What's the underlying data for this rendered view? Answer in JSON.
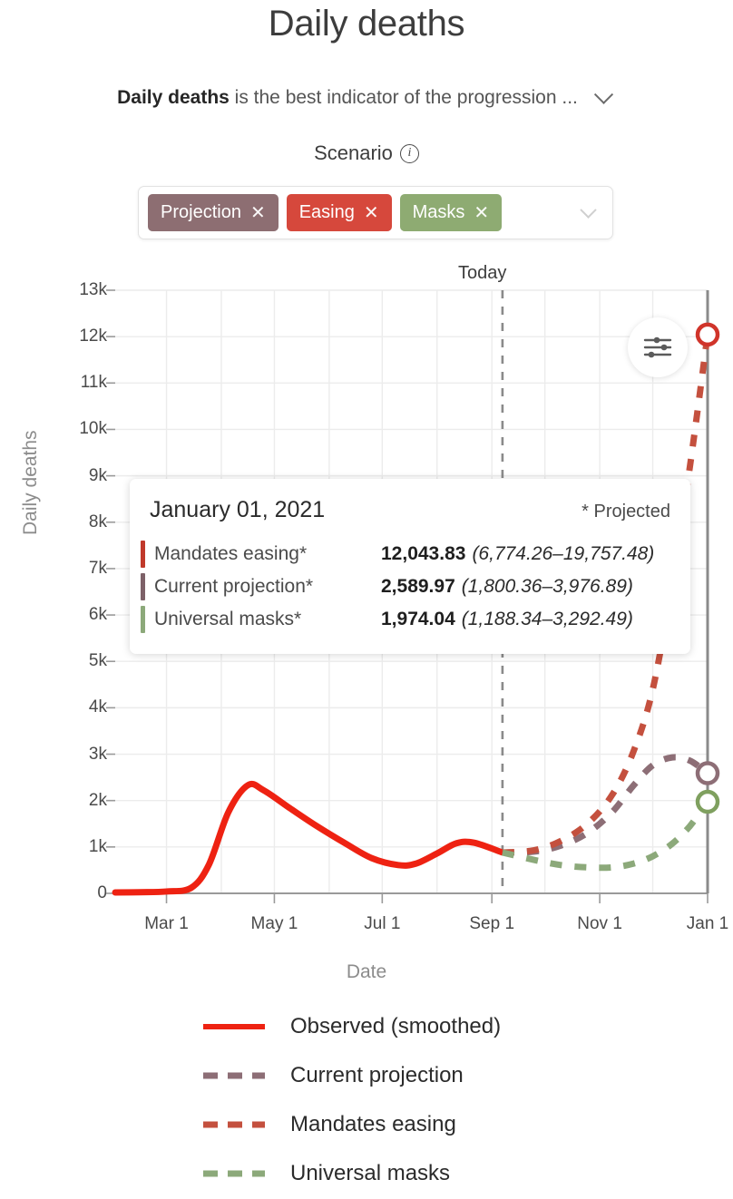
{
  "header": {
    "title": "Daily deaths",
    "subtitle_bold": "Daily deaths",
    "subtitle_rest": " is the best indicator of the progression ...",
    "expand_icon": "chevron-down-icon"
  },
  "scenario": {
    "label": "Scenario",
    "info_icon": "info-icon",
    "pills": [
      {
        "label": "Projection",
        "close": "✕",
        "color": "#8d6e72"
      },
      {
        "label": "Easing",
        "close": "✕",
        "color": "#d6483c"
      },
      {
        "label": "Masks",
        "close": "✕",
        "color": "#8eab72"
      }
    ],
    "dropdown_icon": "chevron-down-icon"
  },
  "chart_labels": {
    "today": "Today",
    "settings_icon": "sliders-icon"
  },
  "tooltip": {
    "date": "January 01, 2021",
    "projected_note": "* Projected",
    "rows": [
      {
        "name": "Mandates easing*",
        "value": "12,043.83",
        "ci": "(6,774.26–19,757.48)",
        "color": "#c0392b"
      },
      {
        "name": "Current projection*",
        "value": "2,589.97",
        "ci": "(1,800.36–3,976.89)",
        "color": "#7d6168"
      },
      {
        "name": "Universal masks*",
        "value": "1,974.04",
        "ci": "(1,188.34–3,292.49)",
        "color": "#8ca97a"
      }
    ]
  },
  "legend": {
    "items": [
      {
        "label": "Observed (smoothed)",
        "color": "#ee2212",
        "style": "solid"
      },
      {
        "label": "Current projection",
        "color": "#8d6e76",
        "style": "dashed"
      },
      {
        "label": "Mandates easing",
        "color": "#c4503e",
        "style": "dashed"
      },
      {
        "label": "Universal masks",
        "color": "#8ca97a",
        "style": "dashed"
      }
    ]
  },
  "chart_data": {
    "type": "line",
    "title": "Daily deaths",
    "xlabel": "Date",
    "ylabel": "Daily deaths",
    "ylim": [
      0,
      13000
    ],
    "ytick_labels": [
      "0",
      "1k",
      "2k",
      "3k",
      "4k",
      "5k",
      "6k",
      "7k",
      "8k",
      "9k",
      "10k",
      "11k",
      "12k",
      "13k"
    ],
    "ytick_values": [
      0,
      1000,
      2000,
      3000,
      4000,
      5000,
      6000,
      7000,
      8000,
      9000,
      10000,
      11000,
      12000,
      13000
    ],
    "xtick_labels": [
      "Mar 1",
      "May 1",
      "Jul 1",
      "Sep 1",
      "Nov 1",
      "Jan 1"
    ],
    "xtick_values": [
      "2020-03-01",
      "2020-05-01",
      "2020-07-01",
      "2020-09-01",
      "2020-11-01",
      "2021-01-01"
    ],
    "xlim": [
      "2020-02-01",
      "2021-01-01"
    ],
    "grid": true,
    "legend_position": "bottom",
    "annotations": [
      {
        "text": "Today",
        "x": "2020-09-07",
        "type": "vertical-dashed-line"
      },
      {
        "text": "* Projected",
        "type": "tooltip-note"
      }
    ],
    "series": [
      {
        "name": "Observed (smoothed)",
        "color": "#ee2212",
        "style": "solid",
        "x": [
          "2020-02-01",
          "2020-02-15",
          "2020-03-01",
          "2020-03-15",
          "2020-03-25",
          "2020-04-05",
          "2020-04-16",
          "2020-04-25",
          "2020-05-10",
          "2020-05-25",
          "2020-06-10",
          "2020-06-25",
          "2020-07-10",
          "2020-07-20",
          "2020-08-01",
          "2020-08-12",
          "2020-08-22",
          "2020-09-07"
        ],
        "values": [
          20,
          25,
          40,
          120,
          620,
          1750,
          2330,
          2220,
          1830,
          1450,
          1080,
          760,
          610,
          640,
          860,
          1080,
          1090,
          880
        ]
      },
      {
        "name": "Current projection",
        "color": "#8d6e76",
        "style": "dashed",
        "x": [
          "2020-09-07",
          "2020-09-25",
          "2020-10-10",
          "2020-10-25",
          "2020-11-08",
          "2020-11-20",
          "2020-12-01",
          "2020-12-12",
          "2020-12-22",
          "2021-01-01"
        ],
        "values": [
          880,
          900,
          1030,
          1300,
          1750,
          2320,
          2760,
          2930,
          2860,
          2589.97
        ],
        "ci_at_end": [
          1800.36,
          3976.89
        ]
      },
      {
        "name": "Mandates easing",
        "color": "#c4503e",
        "style": "dashed",
        "x": [
          "2020-09-07",
          "2020-09-25",
          "2020-10-10",
          "2020-10-25",
          "2020-11-08",
          "2020-11-20",
          "2020-12-01",
          "2020-12-12",
          "2020-12-22",
          "2021-01-01"
        ],
        "values": [
          880,
          930,
          1130,
          1500,
          2120,
          3050,
          4400,
          6700,
          9200,
          12043.83
        ],
        "ci_at_end": [
          6774.26,
          19757.48
        ]
      },
      {
        "name": "Universal masks",
        "color": "#8ca97a",
        "style": "dashed",
        "x": [
          "2020-09-07",
          "2020-09-25",
          "2020-10-10",
          "2020-10-25",
          "2020-11-08",
          "2020-11-20",
          "2020-12-01",
          "2020-12-12",
          "2020-12-22",
          "2021-01-01"
        ],
        "values": [
          880,
          720,
          610,
          560,
          560,
          640,
          800,
          1070,
          1450,
          1974.04
        ],
        "ci_at_end": [
          1188.34,
          3292.49
        ]
      }
    ],
    "end_markers": [
      {
        "series": "Mandates easing",
        "value": 12043.83,
        "color": "#d0342a"
      },
      {
        "series": "Current projection",
        "value": 2589.97,
        "color": "#8d6e76"
      },
      {
        "series": "Universal masks",
        "value": 1974.04,
        "color": "#7fa05f"
      }
    ]
  }
}
